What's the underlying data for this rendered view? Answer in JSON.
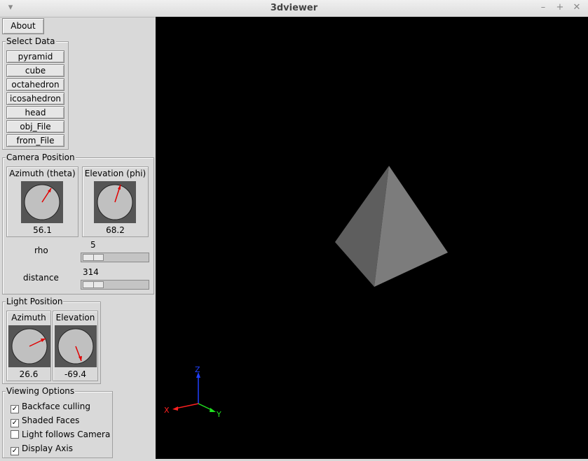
{
  "window": {
    "title": "3dviewer"
  },
  "about_label": "About",
  "select_data": {
    "label": "Select Data",
    "buttons": [
      "pyramid",
      "cube",
      "octahedron",
      "icosahedron",
      "head",
      "obj_File",
      "from_File"
    ]
  },
  "camera": {
    "label": "Camera Position",
    "azimuth": {
      "title": "Azimuth (theta)",
      "value": "56.1"
    },
    "elevation": {
      "title": "Elevation (phi)",
      "value": "68.2"
    },
    "rho": {
      "label": "rho",
      "value": "5"
    },
    "distance": {
      "label": "distance",
      "value": "314"
    }
  },
  "light": {
    "label": "Light Position",
    "azimuth": {
      "title": "Azimuth",
      "value": "26.6"
    },
    "elevation": {
      "title": "Elevation",
      "value": "-69.4"
    }
  },
  "viewing": {
    "label": "Viewing Options",
    "options": [
      {
        "label": "Backface culling",
        "checked": true
      },
      {
        "label": "Shaded Faces",
        "checked": true
      },
      {
        "label": "Light follows Camera",
        "checked": false
      },
      {
        "label": "Display Axis",
        "checked": true
      }
    ]
  },
  "axes": {
    "x": "X",
    "y": "Y",
    "z": "Z"
  },
  "colors": {
    "axis_x": "#ff2020",
    "axis_y": "#20e020",
    "axis_z": "#2040ff",
    "needle": "#e00000"
  }
}
